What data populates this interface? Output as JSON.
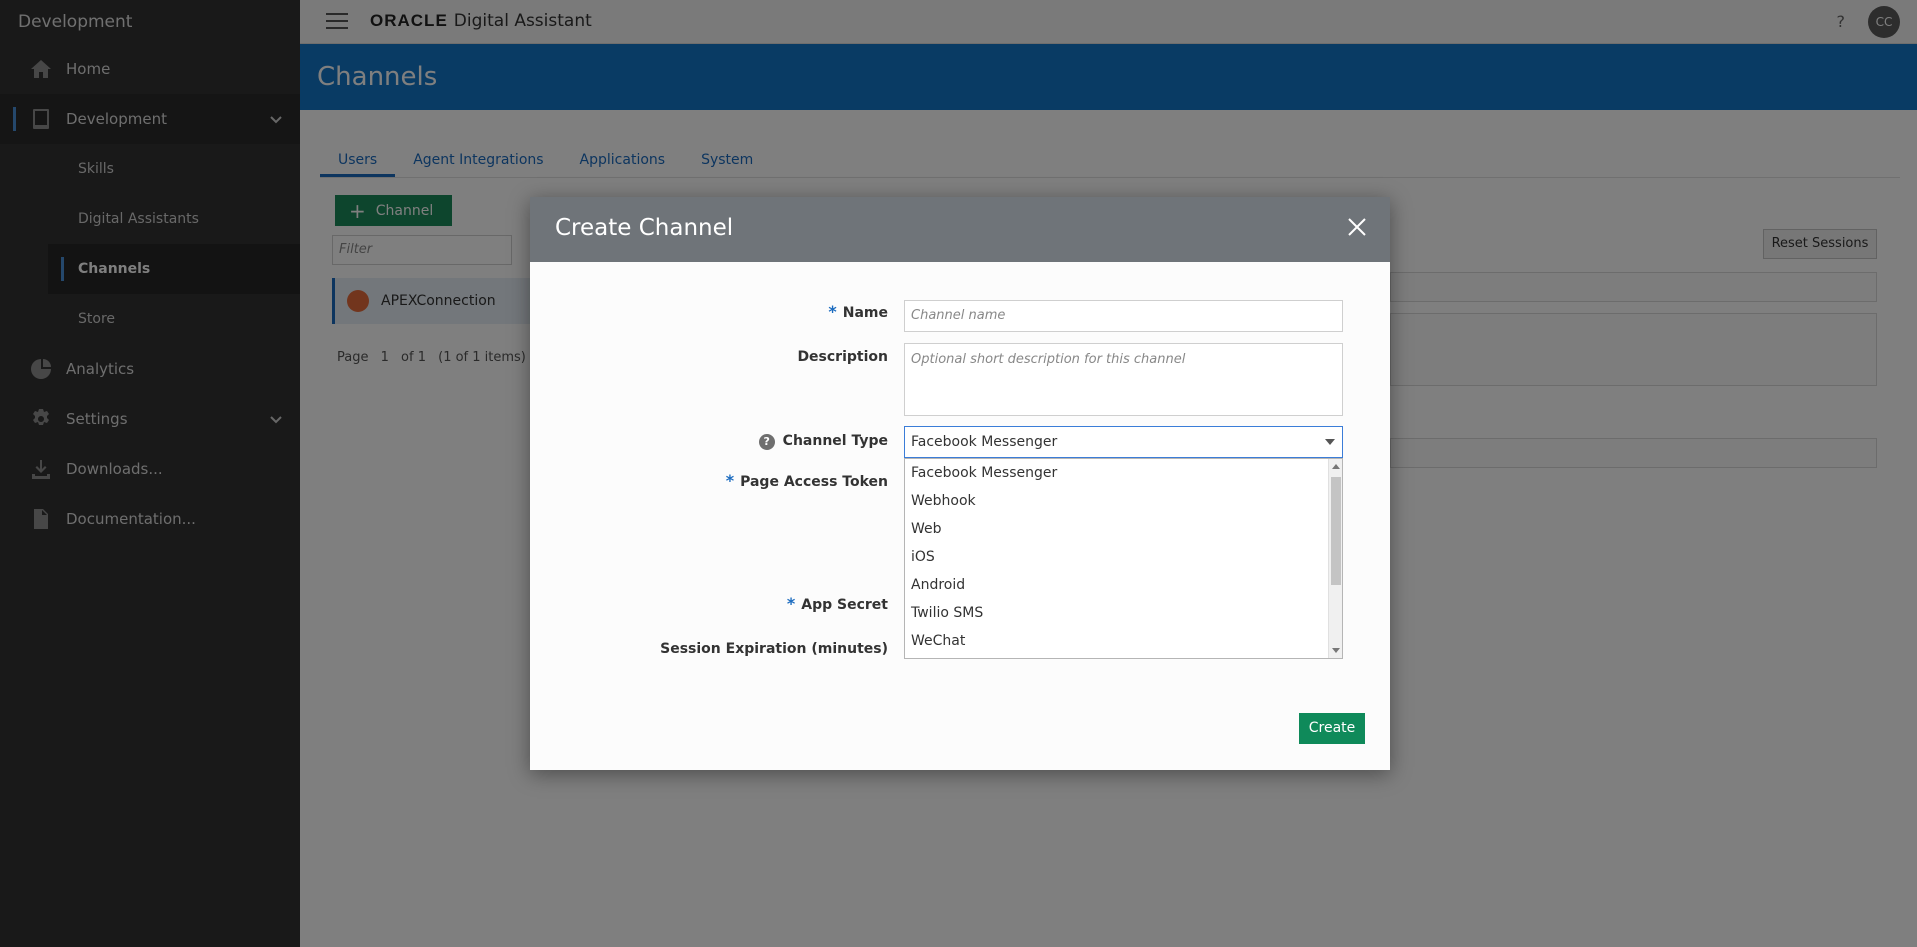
{
  "sidebar": {
    "title": "Development",
    "items": [
      {
        "label": "Home"
      },
      {
        "label": "Development"
      },
      {
        "label": "Analytics"
      },
      {
        "label": "Settings"
      },
      {
        "label": "Downloads..."
      },
      {
        "label": "Documentation..."
      }
    ],
    "sub_items": [
      {
        "label": "Skills"
      },
      {
        "label": "Digital Assistants"
      },
      {
        "label": "Channels"
      },
      {
        "label": "Store"
      }
    ]
  },
  "topbar": {
    "brand_oracle": "ORACLE",
    "brand_product": "Digital Assistant",
    "help": "?",
    "avatar": "CC"
  },
  "header": {
    "title": "Channels"
  },
  "tabs": [
    {
      "label": "Users"
    },
    {
      "label": "Agent Integrations"
    },
    {
      "label": "Applications"
    },
    {
      "label": "System"
    }
  ],
  "list": {
    "add_button": "Channel",
    "filter_placeholder": "Filter",
    "item": "APEXConnection",
    "pager": {
      "page_label": "Page",
      "page": "1",
      "of": "of 1",
      "count": "(1 of 1 items)"
    },
    "reset_button": "Reset Sessions"
  },
  "modal": {
    "title": "Create Channel",
    "name_label": "Name",
    "name_placeholder": "Channel name",
    "description_label": "Description",
    "description_placeholder": "Optional short description for this channel",
    "channel_type_label": "Channel Type",
    "channel_type_value": "Facebook Messenger",
    "channel_type_options": [
      "Facebook Messenger",
      "Webhook",
      "Web",
      "iOS",
      "Android",
      "Twilio SMS",
      "WeChat"
    ],
    "page_access_token_label": "Page Access Token",
    "app_secret_label": "App Secret",
    "session_expiration_label": "Session Expiration (minutes)",
    "create_button": "Create",
    "required_marker": "*",
    "help_marker": "?"
  }
}
